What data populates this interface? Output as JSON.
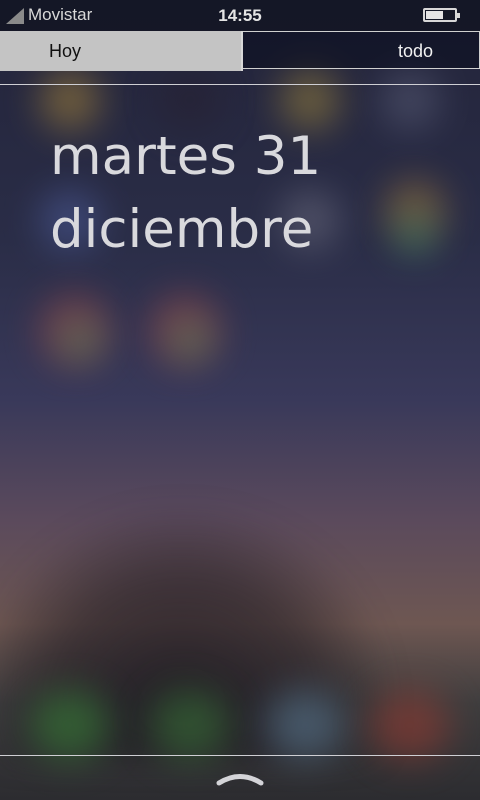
{
  "status_bar": {
    "carrier": "Movistar",
    "time": "14:55",
    "battery_level": 0.55,
    "signal_icon": "signal-icon",
    "battery_icon": "battery-icon"
  },
  "tabs": [
    {
      "label": "Hoy",
      "selected": true
    },
    {
      "label": "todo",
      "selected": false
    }
  ],
  "date": {
    "line1": "martes 31",
    "line2": "diciembre"
  },
  "bottom": {
    "handle_icon": "chevron-up-handle-icon"
  }
}
